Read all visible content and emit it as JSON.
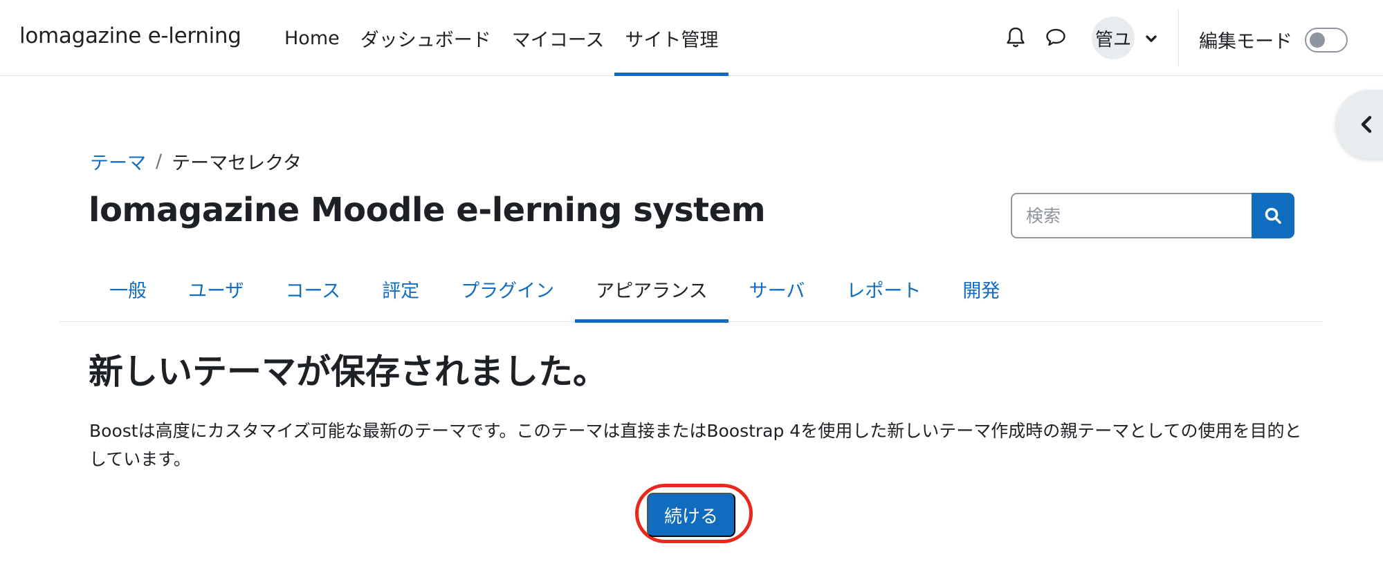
{
  "brand": "lomagazine e-lerning",
  "primary_nav": [
    {
      "label": "Home",
      "active": false
    },
    {
      "label": "ダッシュボード",
      "active": false
    },
    {
      "label": "マイコース",
      "active": false
    },
    {
      "label": "サイト管理",
      "active": true
    }
  ],
  "user": {
    "avatar_initials": "管ユ"
  },
  "edit_mode": {
    "label": "編集モード",
    "enabled": false
  },
  "breadcrumb": {
    "parent": "テーマ",
    "separator": "/",
    "current": "テーマセレクタ"
  },
  "page_title": "lomagazine Moodle e-lerning system",
  "search": {
    "placeholder": "検索",
    "value": ""
  },
  "tabs": [
    {
      "label": "一般",
      "active": false
    },
    {
      "label": "ユーザ",
      "active": false
    },
    {
      "label": "コース",
      "active": false
    },
    {
      "label": "評定",
      "active": false
    },
    {
      "label": "プラグイン",
      "active": false
    },
    {
      "label": "アピアランス",
      "active": true
    },
    {
      "label": "サーバ",
      "active": false
    },
    {
      "label": "レポート",
      "active": false
    },
    {
      "label": "開発",
      "active": false
    }
  ],
  "content": {
    "heading": "新しいテーマが保存されました。",
    "description": "Boostは高度にカスタマイズ可能な最新のテーマです。このテーマは直接またはBoostrap 4を使用した新しいテーマ作成時の親テーマとしての使用を目的としています。",
    "continue_label": "続ける"
  },
  "colors": {
    "accent": "#0f6cbf",
    "highlight": "#e8281c",
    "text": "#1d2125"
  }
}
